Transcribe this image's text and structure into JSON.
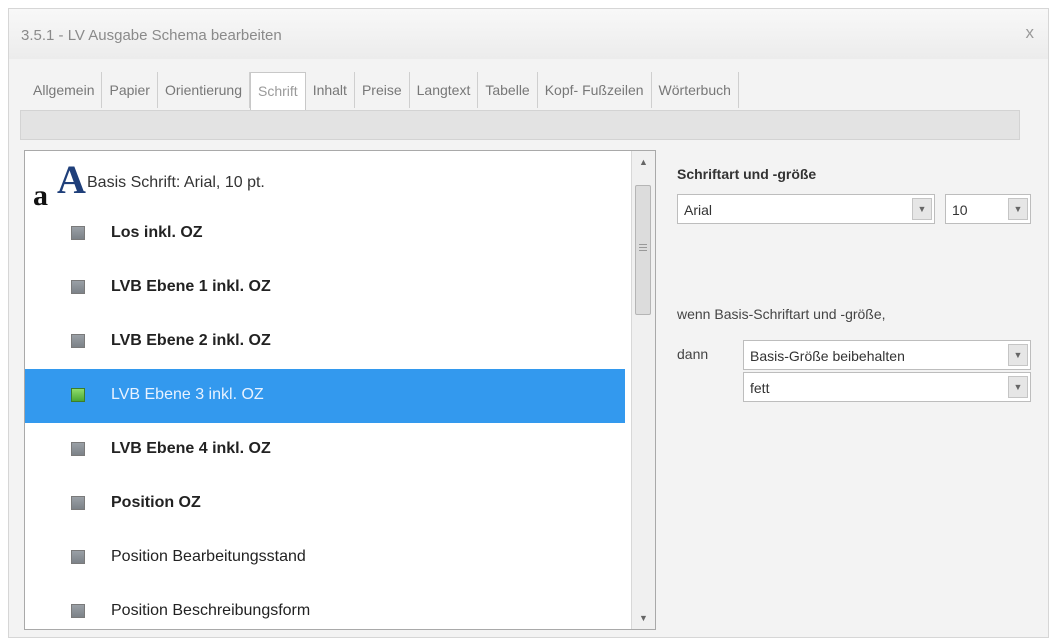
{
  "window": {
    "title": "3.5.1 - LV Ausgabe Schema bearbeiten",
    "close_glyph": "x"
  },
  "tabs": [
    {
      "label": "Allgemein"
    },
    {
      "label": "Papier"
    },
    {
      "label": "Orientierung"
    },
    {
      "label": "Schrift",
      "active": true
    },
    {
      "label": "Inhalt"
    },
    {
      "label": "Preise"
    },
    {
      "label": "Langtext"
    },
    {
      "label": "Tabelle"
    },
    {
      "label": "Kopf- Fußzeilen"
    },
    {
      "label": "Wörterbuch"
    }
  ],
  "font_list": {
    "base_label": "Basis Schrift: Arial, 10 pt.",
    "items": [
      {
        "label": "Los inkl. OZ",
        "bold": true
      },
      {
        "label": "LVB Ebene 1 inkl. OZ",
        "bold": true
      },
      {
        "label": "LVB Ebene 2 inkl. OZ",
        "bold": true
      },
      {
        "label": "LVB Ebene 3 inkl. OZ",
        "bold": true,
        "selected": true
      },
      {
        "label": "LVB Ebene 4 inkl. OZ",
        "bold": true
      },
      {
        "label": "Position OZ",
        "bold": true
      },
      {
        "label": "Position Bearbeitungsstand",
        "bold": false
      },
      {
        "label": "Position Beschreibungsform",
        "bold": false
      }
    ]
  },
  "font_panel": {
    "heading": "Schriftart und -größe",
    "font_name": "Arial",
    "font_size": "10",
    "condition_text": "wenn Basis-Schriftart und -größe,",
    "then_label": "dann",
    "size_option": "Basis-Größe beibehalten",
    "style_option": "fett"
  },
  "colors": {
    "selection": "#3399ee",
    "selected_item_icon": "#5cbf3f"
  }
}
